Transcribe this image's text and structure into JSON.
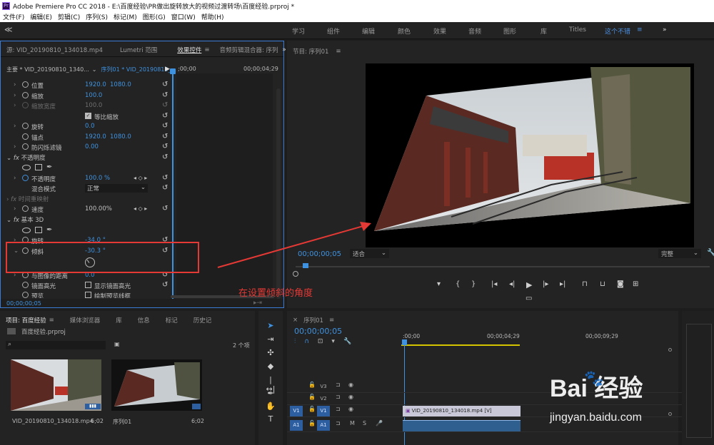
{
  "app": {
    "title": "Adobe Premiere Pro CC 2018 - E:\\百度经验\\PR做出旋转放大的视频过渡转场\\百度经验.prproj *"
  },
  "menu": [
    "文件(F)",
    "编辑(E)",
    "剪辑(C)",
    "序列(S)",
    "标记(M)",
    "图形(G)",
    "窗口(W)",
    "帮助(H)"
  ],
  "workspaces": [
    "学习",
    "组件",
    "编辑",
    "颜色",
    "效果",
    "音频",
    "图形",
    "库",
    "Titles",
    "这个不错"
  ],
  "workspace_more": "»",
  "source_panel": {
    "tabs": [
      "源: VID_20190810_134018.mp4",
      "Lumetri 范围",
      "效果控件",
      "音频剪辑混合器: 序列"
    ],
    "active_tab": "效果控件",
    "master": "主要 * VID_20190810_1340...",
    "sequence_clip": "序列01 * VID_20190810_...",
    "ruler_start": ";00;00",
    "ruler_end": "00;00;04;29",
    "timecode": "00;00;00;05",
    "params": {
      "position": {
        "label": "位置",
        "v1": "1920.0",
        "v2": "1080.0"
      },
      "scale": {
        "label": "缩放",
        "v1": "100.0"
      },
      "scale_width": {
        "label": "缩放宽度",
        "v1": "100.0"
      },
      "uniform_scale": "等比缩放",
      "rotation": {
        "label": "旋转",
        "v1": "0.0"
      },
      "anchor": {
        "label": "锚点",
        "v1": "1920.0",
        "v2": "1080.0"
      },
      "antiflicker": {
        "label": "防闪烁滤镜",
        "v1": "0.00"
      },
      "opacity_section": "不透明度",
      "opacity": {
        "label": "不透明度",
        "v1": "100.0 %"
      },
      "blend": {
        "label": "混合模式",
        "v1": "正常"
      },
      "time_remap": "时间重映射",
      "speed": {
        "label": "速度",
        "v1": "100.00%"
      },
      "basic3d": "基本 3D",
      "rotate3d": {
        "label": "旋转",
        "v1": "-34.0 °"
      },
      "tilt": {
        "label": "倾斜",
        "v1": "-30.3 °"
      },
      "distance": {
        "label": "与图像的距离",
        "v1": "0.0"
      },
      "specular": {
        "label": "镜面高光",
        "v1": "显示镜面高光"
      },
      "preview": {
        "label": "预览",
        "v1": "绘制预览线框"
      }
    }
  },
  "program": {
    "title": "节目: 序列01",
    "timecode": "00;00;00;05",
    "fit": "适合",
    "quality": "完整"
  },
  "annotation": "在设置倾斜的角度",
  "project": {
    "tabs": [
      "项目: 百度经验",
      "媒体浏览器",
      "库",
      "信息",
      "标记",
      "历史记"
    ],
    "file": "百度经验.prproj",
    "count": "2 个项",
    "items": [
      {
        "name": "VID_20190810_134018.mp4",
        "dur": "6;02"
      },
      {
        "name": "序列01",
        "dur": "6;02"
      }
    ]
  },
  "timeline": {
    "title": "序列01",
    "timecode": "00;00;00;05",
    "ruler": [
      ":00;00",
      "00;00;04;29",
      "00;00;09;29"
    ],
    "tracks": [
      "V3",
      "V2",
      "V1",
      "A1"
    ],
    "clip_label": "VID_20190810_134018.mp4 [V]"
  },
  "watermark": {
    "brand": "Bai 经验",
    "url": "jingyan.baidu.com"
  },
  "colors": {
    "accent": "#3f92e0",
    "annotation": "#e53935",
    "panel": "#232323"
  }
}
